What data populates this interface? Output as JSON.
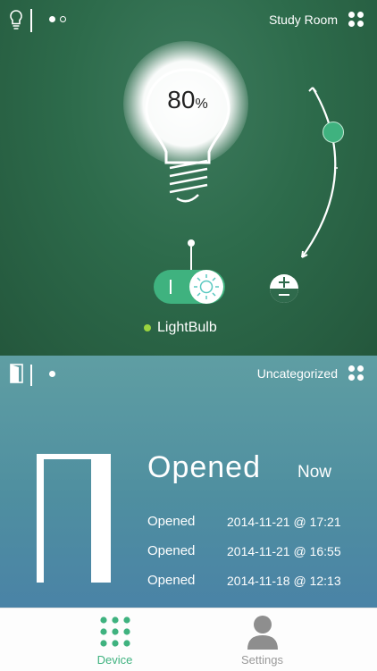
{
  "top_card": {
    "page_indicator_count": 2,
    "room_title": "Study Room",
    "brightness": {
      "value": "80",
      "unit": "%",
      "level_fraction": 0.8
    },
    "device_label": "LightBulb",
    "device_status_color": "#9bd43f",
    "accent_color": "#3fb27f"
  },
  "bottom_card": {
    "title": "Uncategorized",
    "status": "Opened",
    "status_when": "Now",
    "log": [
      {
        "event": "Opened",
        "time": "2014-11-21 @ 17:21"
      },
      {
        "event": "Opened",
        "time": "2014-11-21 @ 16:55"
      },
      {
        "event": "Opened",
        "time": "2014-11-18 @ 12:13"
      }
    ]
  },
  "tabs": [
    {
      "label": "Device",
      "icon": "grid-icon",
      "active": true,
      "color": "#3fb27f"
    },
    {
      "label": "Settings",
      "icon": "person-icon",
      "active": false,
      "color": "#9a9a9a"
    }
  ]
}
